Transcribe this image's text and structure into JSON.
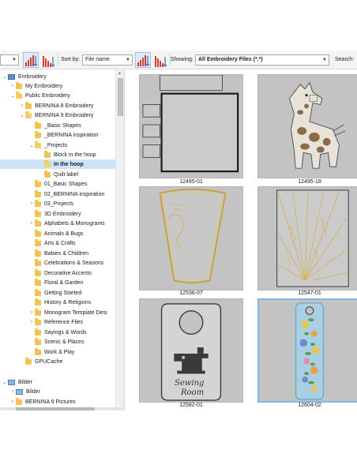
{
  "toolbar": {
    "sort_label": "Sort by:",
    "sort_value": "File name",
    "showing_label": "Showing:",
    "showing_value": "All Embroidery Files (*.*)",
    "search_label": "Search:"
  },
  "tree": {
    "items": [
      {
        "label": "Embroidery",
        "twisty": "⌄"
      },
      {
        "label": "My Embroidery",
        "twisty": "›"
      },
      {
        "label": "Public Embroidery",
        "twisty": "⌄"
      },
      {
        "label": "BERNINA 8 Embroidery",
        "twisty": "›"
      },
      {
        "label": "BERNINA 9 Embroidery",
        "twisty": "⌄"
      },
      {
        "label": "_Basic Shapes",
        "twisty": ""
      },
      {
        "label": "_BERNINA inspiration",
        "twisty": ""
      },
      {
        "label": "_Projects",
        "twisty": "⌄"
      },
      {
        "label": "Block in the hoop",
        "twisty": ""
      },
      {
        "label": "In the hoop",
        "twisty": ""
      },
      {
        "label": "Quilt label",
        "twisty": ""
      },
      {
        "label": "01_Basic Shapes",
        "twisty": ""
      },
      {
        "label": "02_BERNINA inspiration",
        "twisty": ""
      },
      {
        "label": "03_Projects",
        "twisty": "›"
      },
      {
        "label": "3D Embroidery",
        "twisty": ""
      },
      {
        "label": "Alphabets & Monograms",
        "twisty": "›"
      },
      {
        "label": "Animals & Bugs",
        "twisty": ""
      },
      {
        "label": "Arts & Crafts",
        "twisty": ""
      },
      {
        "label": "Babies & Children",
        "twisty": ""
      },
      {
        "label": "Celebrations & Seasons",
        "twisty": ""
      },
      {
        "label": "Decorative Accents",
        "twisty": ""
      },
      {
        "label": "Floral & Garden",
        "twisty": ""
      },
      {
        "label": "Getting Started",
        "twisty": ""
      },
      {
        "label": "History & Religions",
        "twisty": ""
      },
      {
        "label": "Monogram Template Desi",
        "twisty": "›"
      },
      {
        "label": "Reference Files",
        "twisty": "›"
      },
      {
        "label": "Sayings & Words",
        "twisty": ""
      },
      {
        "label": "Scenic & Places",
        "twisty": ""
      },
      {
        "label": "Work & Play",
        "twisty": ""
      },
      {
        "label": "GPUCache",
        "twisty": ""
      },
      {
        "label": "Bilder",
        "twisty": "⌄"
      },
      {
        "label": "Bilder",
        "twisty": "›"
      },
      {
        "label": "BERNINA 9 Pictures",
        "twisty": "›"
      }
    ]
  },
  "gallery": {
    "items": [
      {
        "caption": "12495-01"
      },
      {
        "caption": "12495-18"
      },
      {
        "caption": "12536-07"
      },
      {
        "caption": "12547-01"
      },
      {
        "caption": "12582-01"
      },
      {
        "caption": "12604-02"
      }
    ],
    "design_text": {
      "sewing": "Sewing",
      "room": "Room"
    }
  },
  "colors": {
    "selection": "#cce4f7",
    "folder": "#f2c34d",
    "thumb_bg": "#c3c3c3",
    "thumb_selected_border": "#7fb8e8",
    "sort_arrow_red": "#d2402a",
    "sort_arrow_blue": "#3b6cc4"
  }
}
